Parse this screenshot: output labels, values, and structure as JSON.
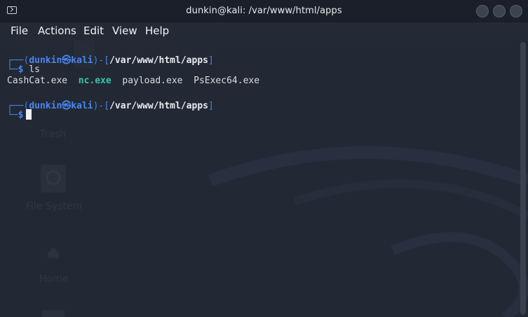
{
  "window": {
    "title": "dunkin@kali: /var/www/html/apps"
  },
  "menu": {
    "file": "File",
    "actions": "Actions",
    "edit": "Edit",
    "view": "View",
    "help": "Help"
  },
  "desktop": {
    "trash_label": "Trash",
    "filesystem_label": "File System",
    "home_label": "Home"
  },
  "prompt1": {
    "open": "┌──(",
    "user": "dunkin",
    "at": "㉿",
    "host": "kali",
    "mid": ")-[",
    "path": "/var/www/html/apps",
    "close": "]",
    "corner": "└─",
    "dollar": "$",
    "command": " ls"
  },
  "ls_output": {
    "file1": "CashCat.exe",
    "file2": "nc.exe",
    "file3": "payload.exe",
    "file4": "PsExec64.exe"
  },
  "prompt2": {
    "open": "┌──(",
    "user": "dunkin",
    "at": "㉿",
    "host": "kali",
    "mid": ")-[",
    "path": "/var/www/html/apps",
    "close": "]",
    "corner": "└─",
    "dollar": "$"
  },
  "colors": {
    "prompt_blue": "#4a86ef",
    "exec_green": "#39c5a8",
    "background": "#222935"
  }
}
